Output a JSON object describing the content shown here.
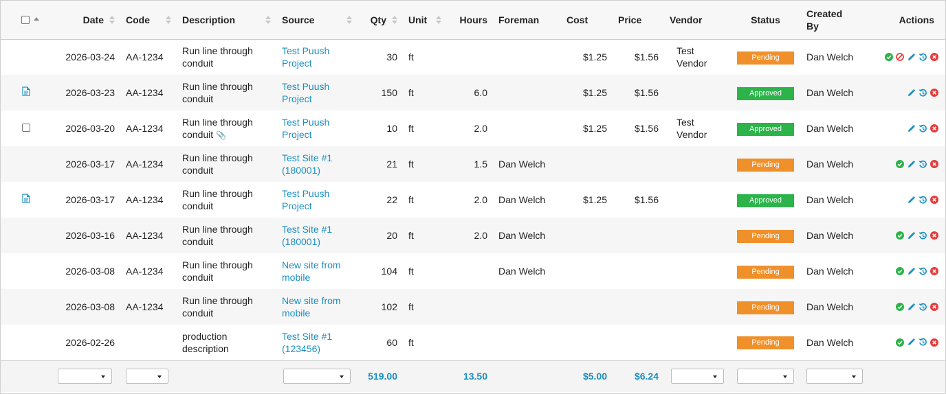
{
  "columns": {
    "date": "Date",
    "code": "Code",
    "description": "Description",
    "source": "Source",
    "qty": "Qty",
    "unit": "Unit",
    "hours": "Hours",
    "foreman": "Foreman",
    "cost": "Cost",
    "price": "Price",
    "vendor": "Vendor",
    "status": "Status",
    "created_by": "Created By",
    "actions": "Actions"
  },
  "rows": [
    {
      "date": "2026-03-24",
      "code": "AA-1234",
      "desc": "Run line through conduit",
      "source": "Test Puush Project",
      "qty": "30",
      "unit": "ft",
      "hours": "",
      "foreman": "",
      "cost": "$1.25",
      "price": "$1.56",
      "vendor": "Test Vendor",
      "status": "Pending",
      "created_by": "Dan Welch"
    },
    {
      "date": "2026-03-23",
      "code": "AA-1234",
      "desc": "Run line through conduit",
      "source": "Test Puush Project",
      "qty": "150",
      "unit": "ft",
      "hours": "6.0",
      "foreman": "",
      "cost": "$1.25",
      "price": "$1.56",
      "vendor": "",
      "status": "Approved",
      "created_by": "Dan Welch"
    },
    {
      "date": "2026-03-20",
      "code": "AA-1234",
      "desc": "Run line through conduit",
      "source": "Test Puush Project",
      "qty": "10",
      "unit": "ft",
      "hours": "2.0",
      "foreman": "",
      "cost": "$1.25",
      "price": "$1.56",
      "vendor": "Test Vendor",
      "status": "Approved",
      "created_by": "Dan Welch"
    },
    {
      "date": "2026-03-17",
      "code": "AA-1234",
      "desc": "Run line through conduit",
      "source": "Test Site #1 (180001)",
      "qty": "21",
      "unit": "ft",
      "hours": "1.5",
      "foreman": "Dan Welch",
      "cost": "",
      "price": "",
      "vendor": "",
      "status": "Pending",
      "created_by": "Dan Welch"
    },
    {
      "date": "2026-03-17",
      "code": "AA-1234",
      "desc": "Run line through conduit",
      "source": "Test Puush Project",
      "qty": "22",
      "unit": "ft",
      "hours": "2.0",
      "foreman": "Dan Welch",
      "cost": "$1.25",
      "price": "$1.56",
      "vendor": "",
      "status": "Approved",
      "created_by": "Dan Welch"
    },
    {
      "date": "2026-03-16",
      "code": "AA-1234",
      "desc": "Run line through conduit",
      "source": "Test Site #1 (180001)",
      "qty": "20",
      "unit": "ft",
      "hours": "2.0",
      "foreman": "Dan Welch",
      "cost": "",
      "price": "",
      "vendor": "",
      "status": "Pending",
      "created_by": "Dan Welch"
    },
    {
      "date": "2026-03-08",
      "code": "AA-1234",
      "desc": "Run line through conduit",
      "source": "New site from mobile",
      "qty": "104",
      "unit": "ft",
      "hours": "",
      "foreman": "Dan Welch",
      "cost": "",
      "price": "",
      "vendor": "",
      "status": "Pending",
      "created_by": "Dan Welch"
    },
    {
      "date": "2026-03-08",
      "code": "AA-1234",
      "desc": "Run line through conduit",
      "source": "New site from mobile",
      "qty": "102",
      "unit": "ft",
      "hours": "",
      "foreman": "",
      "cost": "",
      "price": "",
      "vendor": "",
      "status": "Pending",
      "created_by": "Dan Welch"
    },
    {
      "date": "2026-02-26",
      "code": "",
      "desc": "production description",
      "source": "Test Site #1 (123456)",
      "qty": "60",
      "unit": "ft",
      "hours": "",
      "foreman": "",
      "cost": "",
      "price": "",
      "vendor": "",
      "status": "Pending",
      "created_by": "Dan Welch"
    }
  ],
  "totals": {
    "qty": "519.00",
    "hours": "13.50",
    "cost": "$5.00",
    "price": "$6.24"
  },
  "colors": {
    "link": "#1a8fc0",
    "pending": "#f0902a",
    "approved": "#2cb34a",
    "approve_icon": "#2cb34a",
    "reject_icon": "#e43d3d",
    "edit_icon": "#1a8fc0",
    "history_icon": "#1a8fc0",
    "delete_icon": "#e43d3d"
  },
  "icons": {
    "lead": [
      "none",
      "document-icon",
      "checkbox",
      "none",
      "document-icon",
      "none",
      "none",
      "none",
      "none"
    ],
    "attachment_row": 2,
    "actions": [
      [
        "approve-icon",
        "reject-icon",
        "edit-icon",
        "history-icon",
        "delete-icon"
      ],
      [
        "edit-icon",
        "history-icon",
        "delete-icon"
      ],
      [
        "edit-icon",
        "history-icon",
        "delete-icon"
      ],
      [
        "approve-icon",
        "edit-icon",
        "history-icon",
        "delete-icon"
      ],
      [
        "edit-icon",
        "history-icon",
        "delete-icon"
      ],
      [
        "approve-icon",
        "edit-icon",
        "history-icon",
        "delete-icon"
      ],
      [
        "approve-icon",
        "edit-icon",
        "history-icon",
        "delete-icon"
      ],
      [
        "approve-icon",
        "edit-icon",
        "history-icon",
        "delete-icon"
      ],
      [
        "approve-icon",
        "edit-icon",
        "history-icon",
        "delete-icon"
      ]
    ]
  }
}
